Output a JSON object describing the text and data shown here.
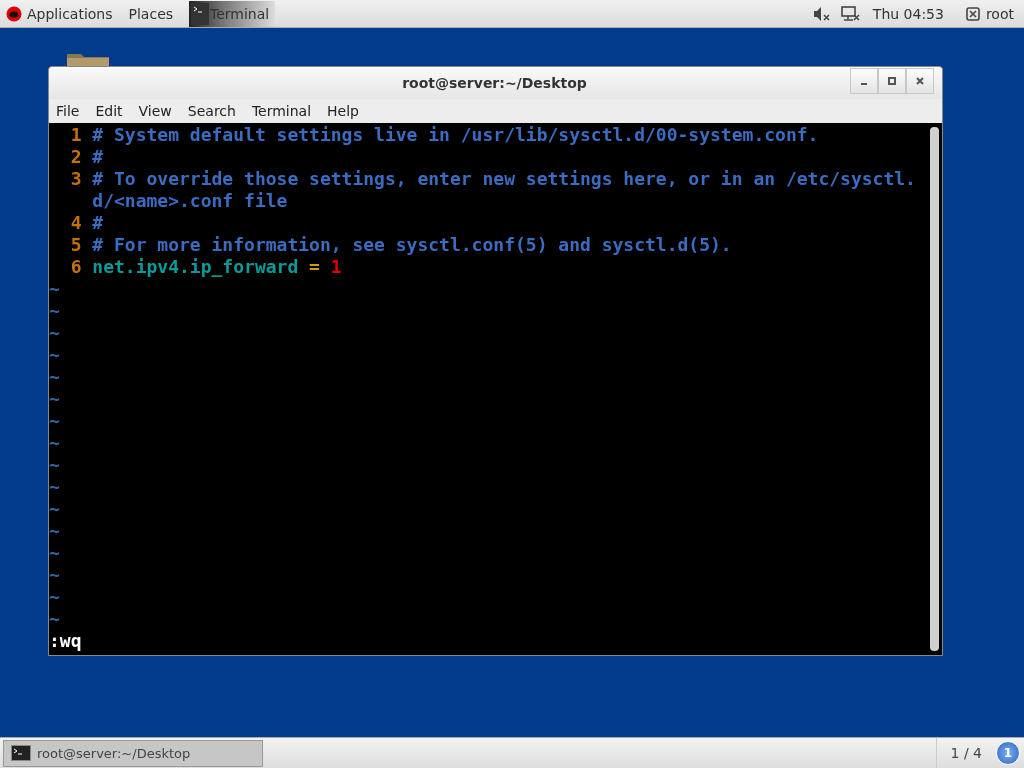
{
  "top_bar": {
    "menus": [
      {
        "label": "Applications"
      },
      {
        "label": "Places"
      }
    ],
    "active_app": {
      "label": "Terminal"
    },
    "clock": "Thu 04:53",
    "user": "root"
  },
  "window": {
    "title": "root@server:~/Desktop",
    "menu": [
      "File",
      "Edit",
      "View",
      "Search",
      "Terminal",
      "Help"
    ]
  },
  "editor": {
    "lines": [
      {
        "number": "1",
        "segments": [
          {
            "kind": "comment",
            "text": "# System default settings live in /usr/lib/sysctl.d/00-system.conf."
          }
        ]
      },
      {
        "number": "2",
        "segments": [
          {
            "kind": "comment",
            "text": "#"
          }
        ]
      },
      {
        "number": "3",
        "segments": [
          {
            "kind": "comment",
            "text": "# To override those settings, enter new settings here, or in an /etc/sysctl.d/<name>.conf file"
          }
        ]
      },
      {
        "number": "4",
        "segments": [
          {
            "kind": "comment",
            "text": "#"
          }
        ]
      },
      {
        "number": "5",
        "segments": [
          {
            "kind": "comment",
            "text": "# For more information, see sysctl.conf(5) and sysctl.d(5)."
          }
        ]
      },
      {
        "number": "6",
        "segments": [
          {
            "kind": "key",
            "text": "net.ipv4.ip_forward"
          },
          {
            "kind": "operator",
            "text": " = "
          },
          {
            "kind": "value",
            "text": "1"
          }
        ]
      }
    ],
    "tildes": [
      "~",
      "~",
      "~",
      "~",
      "~",
      "~",
      "~",
      "~",
      "~",
      "~",
      "~",
      "~",
      "~",
      "~",
      "~",
      "~"
    ],
    "command": ":wq"
  },
  "taskbar": {
    "tasks": [
      {
        "label": "root@server:~/Desktop",
        "selected": true
      }
    ],
    "workspace": "1 / 4",
    "notification_count": "1"
  }
}
